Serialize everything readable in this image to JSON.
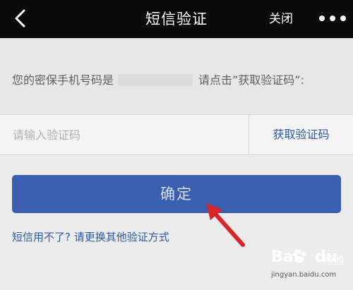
{
  "colors": {
    "topbar_bg": "#0a0a0a",
    "page_bg": "#ececec",
    "link": "#2a5aa8",
    "primary_button": "#3b5fb0",
    "annotation_arrow": "#d9242a"
  },
  "header": {
    "back_icon": "chevron-left-icon",
    "title": "短信验证",
    "close_label": "关闭",
    "more_icon": "more-horizontal-icon"
  },
  "info": {
    "text_before": "您的密保手机号码是",
    "text_after": "请点击”获取验证码”:"
  },
  "code_input": {
    "placeholder": "请输入验证码",
    "value": ""
  },
  "get_code_label": "获取验证码",
  "confirm_label": "确定",
  "alt_link": "短信用不了? 请更换其他验证方式",
  "watermark": {
    "url": "jingyan.baidu.com"
  }
}
